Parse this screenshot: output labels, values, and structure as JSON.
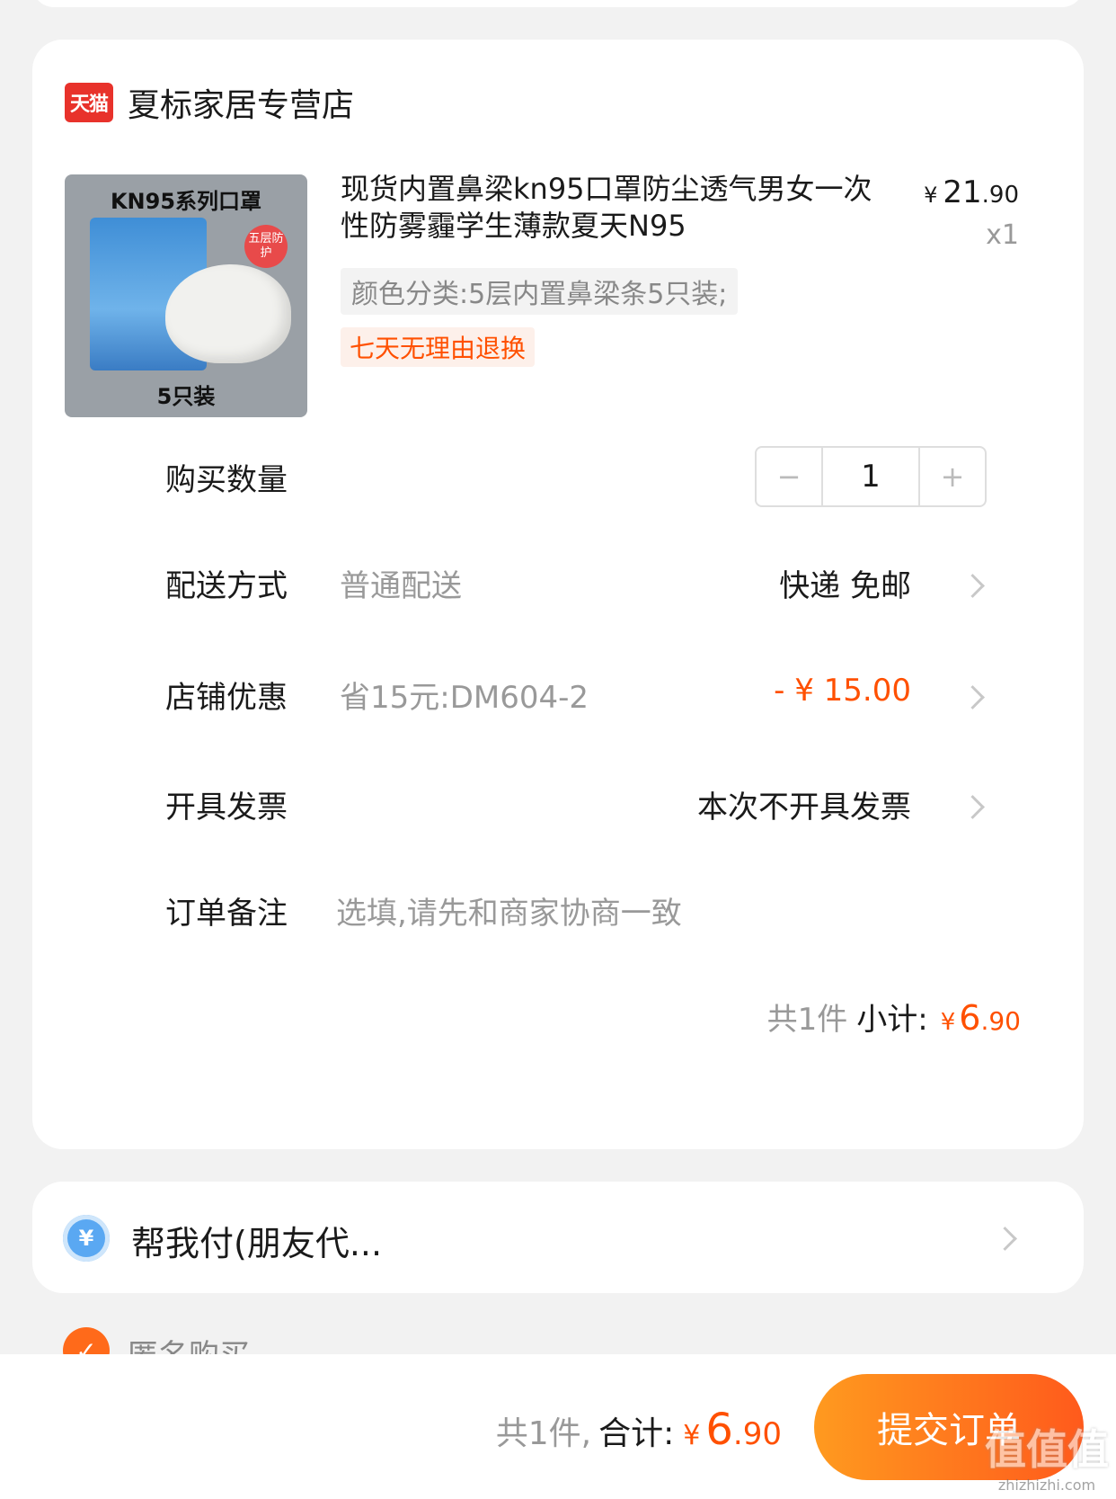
{
  "store": {
    "badge_text": "天猫",
    "name": "夏标家居专营店"
  },
  "product": {
    "thumb_title": "KN95系列口罩",
    "thumb_badge": "五层防护",
    "thumb_count": "5只装",
    "title": "现货内置鼻梁kn95口罩防尘透气男女一次性防雾霾学生薄款夏天N95",
    "price_symbol": "¥",
    "price_int": "21",
    "price_dec": ".90",
    "quantity_label": "x1",
    "sku": "颜色分类:5层内置鼻梁条5只装;",
    "service_tag": "七天无理由退换"
  },
  "purchase_qty": {
    "label": "购买数量",
    "minus": "−",
    "value": "1",
    "plus": "+"
  },
  "delivery": {
    "label": "配送方式",
    "desc": "普通配送",
    "value": "快递 免邮"
  },
  "discount": {
    "label": "店铺优惠",
    "desc": "省15元:DM604-2",
    "value": "- ¥ 15.00"
  },
  "invoice": {
    "label": "开具发票",
    "value": "本次不开具发票"
  },
  "note": {
    "label": "订单备注",
    "placeholder": "选填,请先和商家协商一致"
  },
  "subtotal": {
    "count": "共1件",
    "label": "小计:",
    "symbol": "¥",
    "int": "6",
    "dec": ".90"
  },
  "friend_pay": {
    "icon": "¥",
    "label": "帮我付(朋友代..."
  },
  "anonymous": {
    "label": "匿名购买"
  },
  "footer": {
    "count": "共1件,",
    "label": "合计:",
    "symbol": "¥",
    "int": "6",
    "dec": ".90",
    "submit_label": "提交订单"
  },
  "watermark": {
    "logo": "值值值",
    "url": "zhizhizhi.com"
  },
  "colors": {
    "accent": "#ff5000",
    "button_start": "#ff9a1f",
    "button_end": "#ff5a1c",
    "tmall_red": "#e8322b"
  }
}
